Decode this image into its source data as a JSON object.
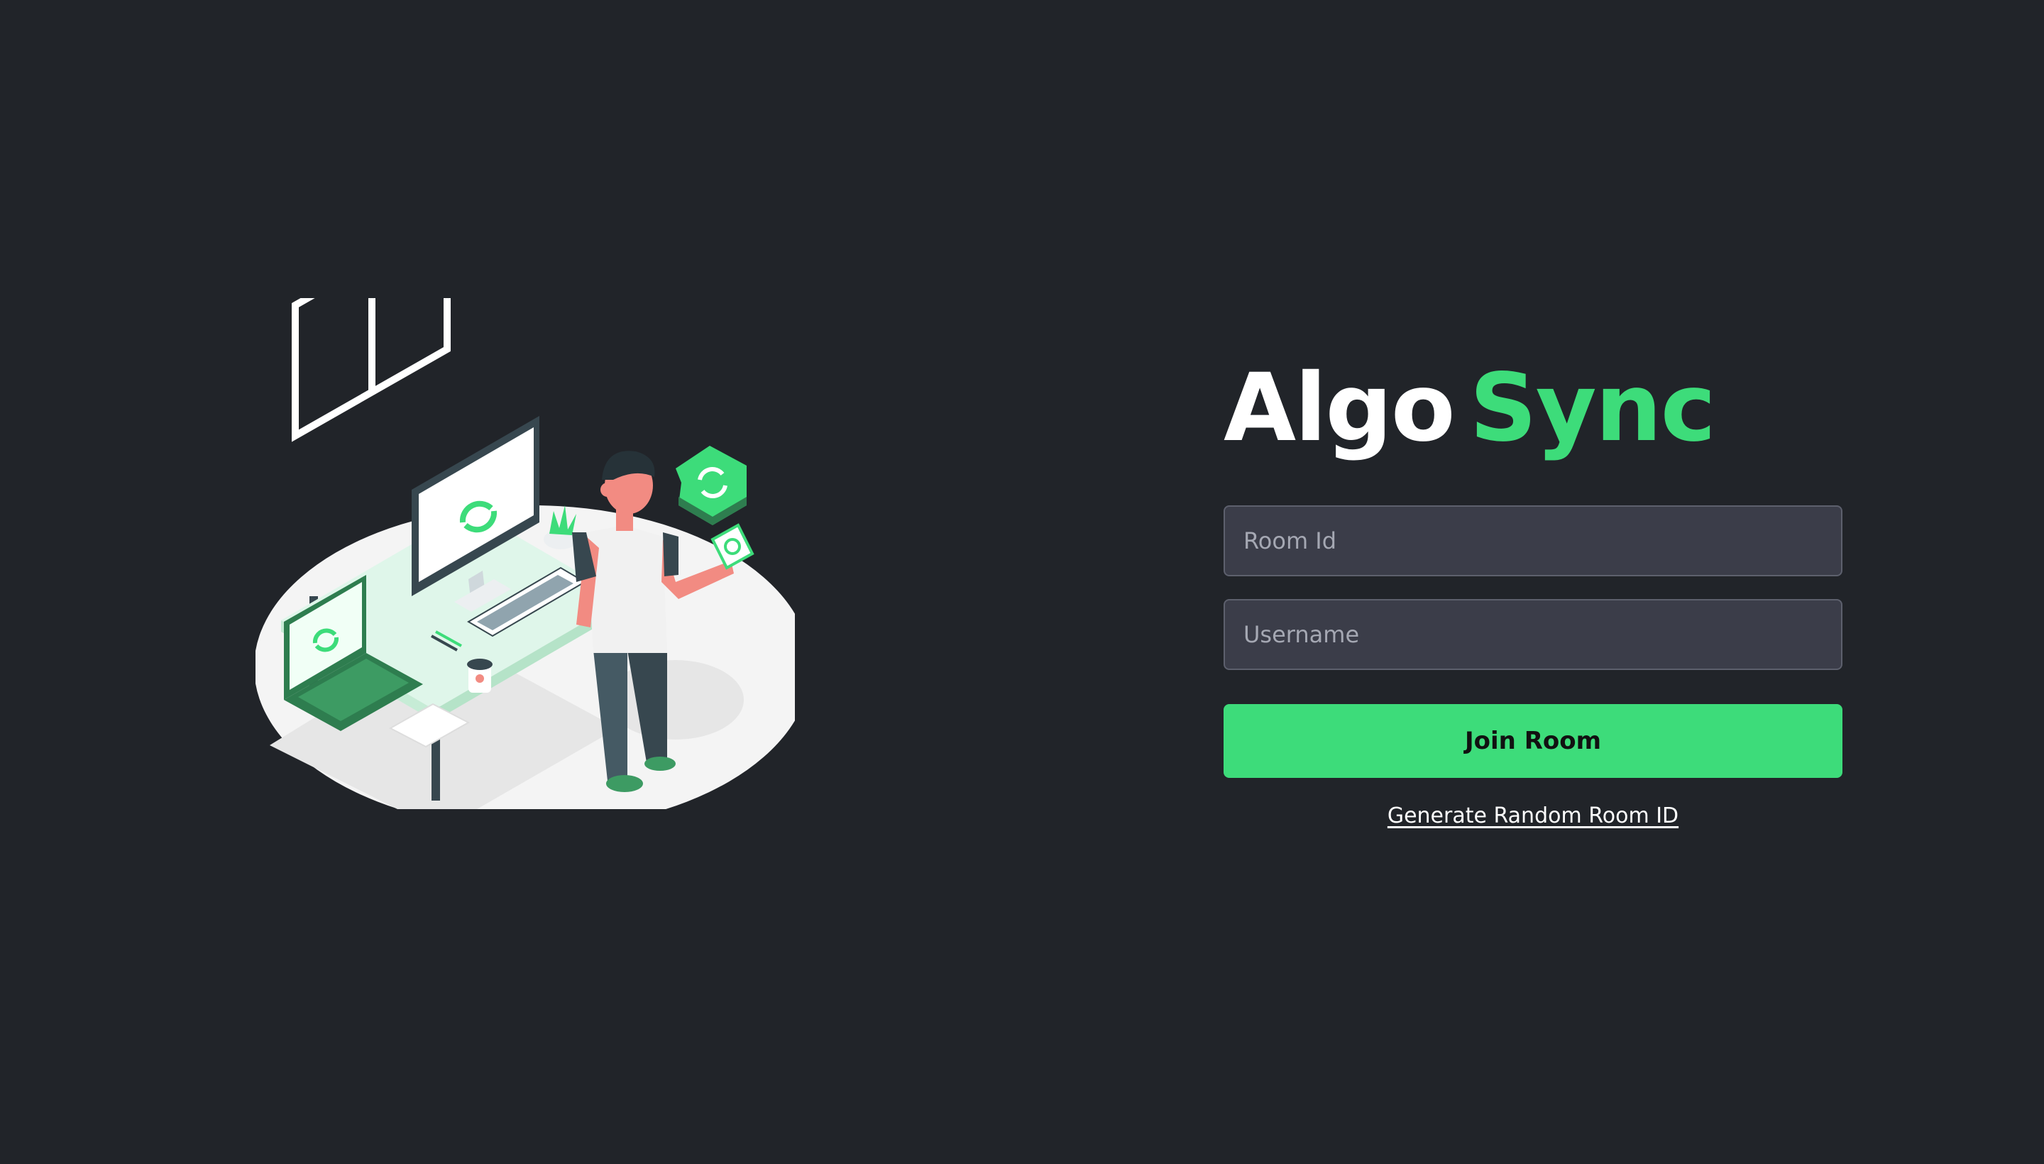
{
  "brand": {
    "algo": "Algo",
    "sync": "Sync"
  },
  "form": {
    "room_id_placeholder": "Room Id",
    "room_id_value": "",
    "username_placeholder": "Username",
    "username_value": "",
    "join_label": "Join Room",
    "generate_label": "Generate Random Room ID"
  },
  "colors": {
    "background": "#212429",
    "accent": "#3ddc7a",
    "input_bg": "#3b3d49",
    "input_border": "#5d606d"
  },
  "illustration": {
    "icon": "person-at-desk-sync-illustration"
  }
}
